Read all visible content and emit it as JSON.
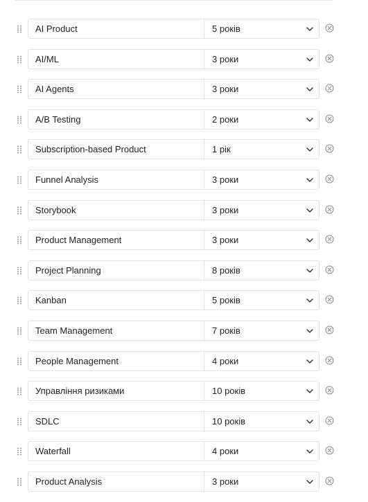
{
  "skills": [
    {
      "name": "AI Product",
      "years": "5 років"
    },
    {
      "name": "AI/ML",
      "years": "3 роки"
    },
    {
      "name": "AI Agents",
      "years": "3 роки"
    },
    {
      "name": "A/B Testing",
      "years": "2 роки"
    },
    {
      "name": "Subscription-based Product",
      "years": "1 рік"
    },
    {
      "name": "Funnel Analysis",
      "years": "3 роки"
    },
    {
      "name": "Storybook",
      "years": "3 роки"
    },
    {
      "name": "Product Management",
      "years": "3 роки"
    },
    {
      "name": "Project Planning",
      "years": "8 років"
    },
    {
      "name": "Kanban",
      "years": "5 років"
    },
    {
      "name": "Team Management",
      "years": "7 років"
    },
    {
      "name": "People Management",
      "years": "4 роки"
    },
    {
      "name": "Управління ризиками",
      "years": "10 років"
    },
    {
      "name": "SDLC",
      "years": "10 років"
    },
    {
      "name": "Waterfall",
      "years": "4 роки"
    },
    {
      "name": "Product Analysis",
      "years": "3 роки"
    }
  ],
  "icons": {
    "drag": "drag-handle-icon",
    "chevron": "chevron-down-icon",
    "remove": "close-circle-icon"
  },
  "colors": {
    "border": "#e3e4e8",
    "text": "#1f2024",
    "icon": "#8b8e96"
  }
}
